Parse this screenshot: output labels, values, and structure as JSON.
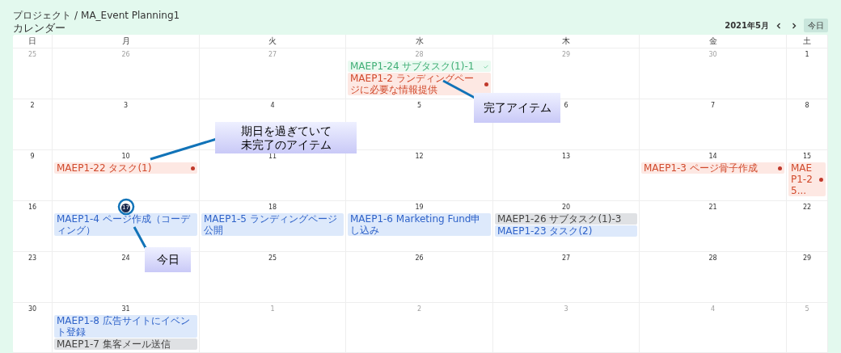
{
  "breadcrumb": {
    "items": [
      "プロジェクト",
      "MA_Event Planning1"
    ],
    "separator": "/"
  },
  "title": "カレンダー",
  "toolbar": {
    "month": "2021年5月",
    "today_button": "今日"
  },
  "weekdays": [
    "日",
    "月",
    "火",
    "水",
    "木",
    "金",
    "土"
  ],
  "weeks": [
    [
      {
        "day": "25",
        "in_month": false,
        "today": false
      },
      {
        "day": "26",
        "in_month": false,
        "today": false
      },
      {
        "day": "27",
        "in_month": false,
        "today": false
      },
      {
        "day": "28",
        "in_month": false,
        "today": false,
        "events": [
          {
            "label": "MAEP1-24 サブタスク(1)-1",
            "kind": "done"
          },
          {
            "label": "MAEP1-2 ランディングページに必要な情報提供",
            "kind": "overdue"
          }
        ]
      },
      {
        "day": "29",
        "in_month": false,
        "today": false
      },
      {
        "day": "30",
        "in_month": false,
        "today": false
      },
      {
        "day": "1",
        "in_month": true,
        "today": false
      }
    ],
    [
      {
        "day": "2",
        "in_month": true,
        "today": false
      },
      {
        "day": "3",
        "in_month": true,
        "today": false
      },
      {
        "day": "4",
        "in_month": true,
        "today": false
      },
      {
        "day": "5",
        "in_month": true,
        "today": false
      },
      {
        "day": "6",
        "in_month": true,
        "today": false
      },
      {
        "day": "7",
        "in_month": true,
        "today": false
      },
      {
        "day": "8",
        "in_month": true,
        "today": false
      }
    ],
    [
      {
        "day": "9",
        "in_month": true,
        "today": false
      },
      {
        "day": "10",
        "in_month": true,
        "today": false,
        "events": [
          {
            "label": "MAEP1-22 タスク(1)",
            "kind": "overdue"
          }
        ]
      },
      {
        "day": "11",
        "in_month": true,
        "today": false
      },
      {
        "day": "12",
        "in_month": true,
        "today": false
      },
      {
        "day": "13",
        "in_month": true,
        "today": false
      },
      {
        "day": "14",
        "in_month": true,
        "today": false,
        "events": [
          {
            "label": "MAEP1-3 ページ骨子作成",
            "kind": "overdue"
          }
        ]
      },
      {
        "day": "15",
        "in_month": true,
        "today": false,
        "events": [
          {
            "label": "MAEP1-25...",
            "kind": "overdue"
          }
        ]
      }
    ],
    [
      {
        "day": "16",
        "in_month": true,
        "today": false
      },
      {
        "day": "17",
        "in_month": true,
        "today": true,
        "events": [
          {
            "label": "MAEP1-4 ページ作成（コーディング）",
            "kind": "open"
          }
        ]
      },
      {
        "day": "18",
        "in_month": true,
        "today": false,
        "events": [
          {
            "label": "MAEP1-5 ランディングページ公開",
            "kind": "open"
          }
        ]
      },
      {
        "day": "19",
        "in_month": true,
        "today": false,
        "events": [
          {
            "label": "MAEP1-6 Marketing Fund申し込み",
            "kind": "open"
          }
        ]
      },
      {
        "day": "20",
        "in_month": true,
        "today": false,
        "events": [
          {
            "label": "MAEP1-26 サブタスク(1)-3",
            "kind": "progress"
          },
          {
            "label": "MAEP1-23 タスク(2)",
            "kind": "open"
          }
        ]
      },
      {
        "day": "21",
        "in_month": true,
        "today": false
      },
      {
        "day": "22",
        "in_month": true,
        "today": false
      }
    ],
    [
      {
        "day": "23",
        "in_month": true,
        "today": false
      },
      {
        "day": "24",
        "in_month": true,
        "today": false
      },
      {
        "day": "25",
        "in_month": true,
        "today": false
      },
      {
        "day": "26",
        "in_month": true,
        "today": false
      },
      {
        "day": "27",
        "in_month": true,
        "today": false
      },
      {
        "day": "28",
        "in_month": true,
        "today": false
      },
      {
        "day": "29",
        "in_month": true,
        "today": false
      }
    ],
    [
      {
        "day": "30",
        "in_month": true,
        "today": false
      },
      {
        "day": "31",
        "in_month": true,
        "today": false,
        "events": [
          {
            "label": "MAEP1-8 広告サイトにイベント登録",
            "kind": "open"
          },
          {
            "label": "MAEP1-7 集客メール送信",
            "kind": "progress"
          }
        ]
      },
      {
        "day": "1",
        "in_month": false,
        "today": false
      },
      {
        "day": "2",
        "in_month": false,
        "today": false
      },
      {
        "day": "3",
        "in_month": false,
        "today": false
      },
      {
        "day": "4",
        "in_month": false,
        "today": false
      },
      {
        "day": "5",
        "in_month": false,
        "today": false
      }
    ]
  ],
  "callouts": [
    {
      "text": "完了アイテム"
    },
    {
      "text": "期日を過ぎていて未完了のアイテム"
    },
    {
      "text": "今日"
    }
  ]
}
